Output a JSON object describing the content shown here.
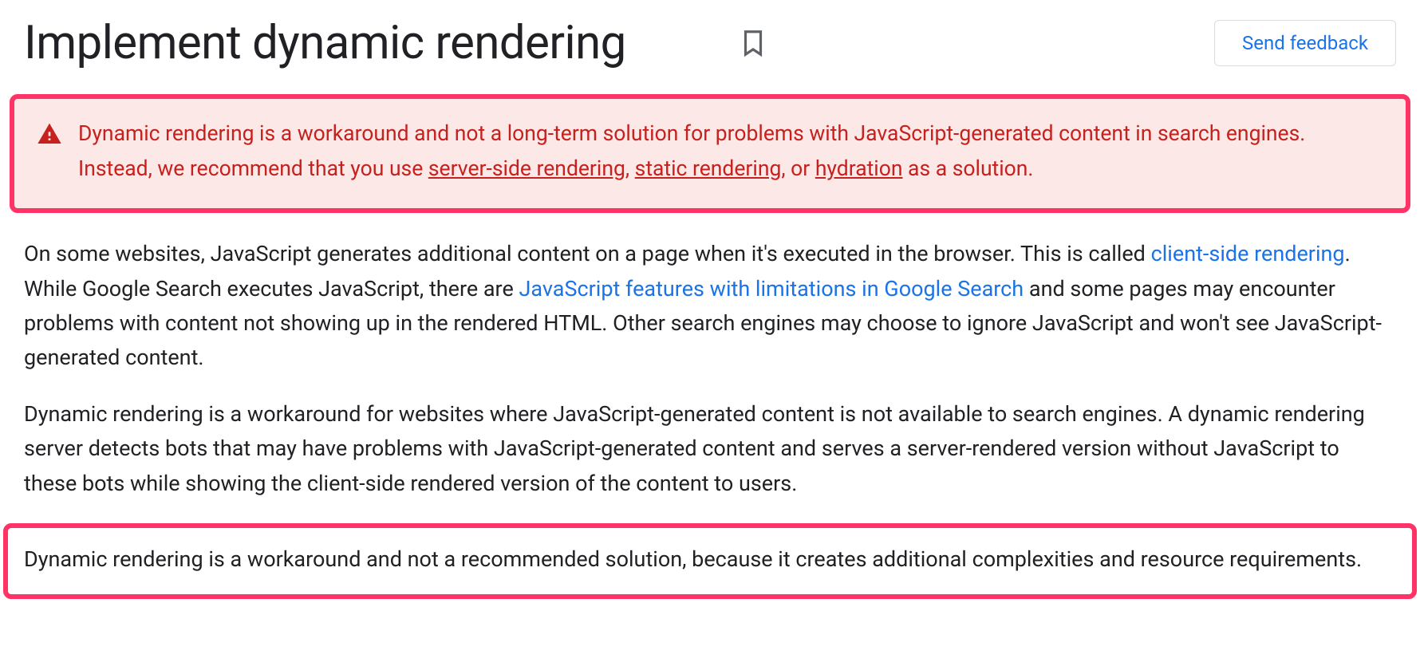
{
  "header": {
    "title": "Implement dynamic rendering",
    "feedback_label": "Send feedback"
  },
  "alert": {
    "text_before_links": "Dynamic rendering is a workaround and not a long-term solution for problems with JavaScript-generated content in search engines. Instead, we recommend that you use ",
    "link1": "server-side rendering",
    "sep1": ", ",
    "link2": "static rendering",
    "sep2": ", or ",
    "link3": "hydration",
    "text_after_links": " as a solution."
  },
  "paragraph1": {
    "part1": "On some websites, JavaScript generates additional content on a page when it's executed in the browser. This is called ",
    "link1": "client-side rendering",
    "part2": ". While Google Search executes JavaScript, there are ",
    "link2": "JavaScript features with limitations in Google Search",
    "part3": " and some pages may encounter problems with content not showing up in the rendered HTML. Other search engines may choose to ignore JavaScript and won't see JavaScript-generated content."
  },
  "paragraph2": "Dynamic rendering is a workaround for websites where JavaScript-generated content is not available to search engines. A dynamic rendering server detects bots that may have problems with JavaScript-generated content and serves a server-rendered version without JavaScript to these bots while showing the client-side rendered version of the content to users.",
  "paragraph3": "Dynamic rendering is a workaround and not a recommended solution, because it creates additional complexities and resource requirements."
}
